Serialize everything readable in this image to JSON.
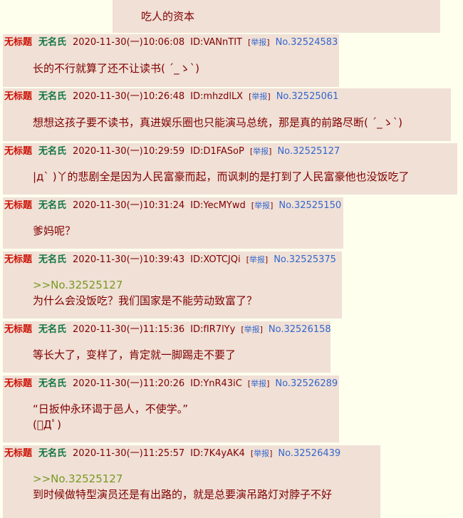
{
  "top_post": {
    "content": "吃人的资本"
  },
  "replies": [
    {
      "title": "无标题",
      "name": "无名氏",
      "time": "2020-11-30(一)10:06:08",
      "id": "ID:VANnTIT",
      "report": "举报",
      "no": "No.32524583",
      "quote": "",
      "lines": [
        "长的不行就算了还不让读书( ´_ゝ`)"
      ]
    },
    {
      "title": "无标题",
      "name": "无名氏",
      "time": "2020-11-30(一)10:26:48",
      "id": "ID:mhzdlLX",
      "report": "举报",
      "no": "No.32525061",
      "quote": "",
      "lines": [
        "想想这孩子要不读书，真进娱乐圈也只能演马总统，那是真的前路尽断( ´_ゝ`)"
      ]
    },
    {
      "title": "无标题",
      "name": "无名氏",
      "time": "2020-11-30(一)10:29:59",
      "id": "ID:D1FASoP",
      "report": "举报",
      "no": "No.32525127",
      "quote": "",
      "lines": [
        "|д` )丫的悲剧全是因为人民富豪而起，而讽刺的是打到了人民富豪他也没饭吃了"
      ]
    },
    {
      "title": "无标题",
      "name": "无名氏",
      "time": "2020-11-30(一)10:31:24",
      "id": "ID:YecMYwd",
      "report": "举报",
      "no": "No.32525150",
      "quote": "",
      "lines": [
        "爹妈呢？"
      ]
    },
    {
      "title": "无标题",
      "name": "无名氏",
      "time": "2020-11-30(一)10:39:43",
      "id": "ID:XOTCJQi",
      "report": "举报",
      "no": "No.32525375",
      "quote": ">>No.32525127",
      "lines": [
        "为什么会没饭吃？我们国家是不能劳动致富了？"
      ]
    },
    {
      "title": "无标题",
      "name": "无名氏",
      "time": "2020-11-30(一)11:15:36",
      "id": "ID:fIR7lYy",
      "report": "举报",
      "no": "No.32526158",
      "quote": "",
      "lines": [
        "等长大了，变样了，肯定就一脚踢走不要了"
      ]
    },
    {
      "title": "无标题",
      "name": "无名氏",
      "time": "2020-11-30(一)11:20:26",
      "id": "ID:YnR43iC",
      "report": "举报",
      "no": "No.32526289",
      "quote": "",
      "lines": [
        "“日扳仲永环谒于邑人，不使学。”",
        "(ﾟДﾟ)"
      ]
    },
    {
      "title": "无标题",
      "name": "无名氏",
      "time": "2020-11-30(一)11:25:57",
      "id": "ID:7K4yAK4",
      "report": "举报",
      "no": "No.32526439",
      "quote": ">>No.32525127",
      "lines": [
        "到时候做特型演员还是有出路的，就是总要演吊路灯对脖子不好"
      ]
    }
  ]
}
